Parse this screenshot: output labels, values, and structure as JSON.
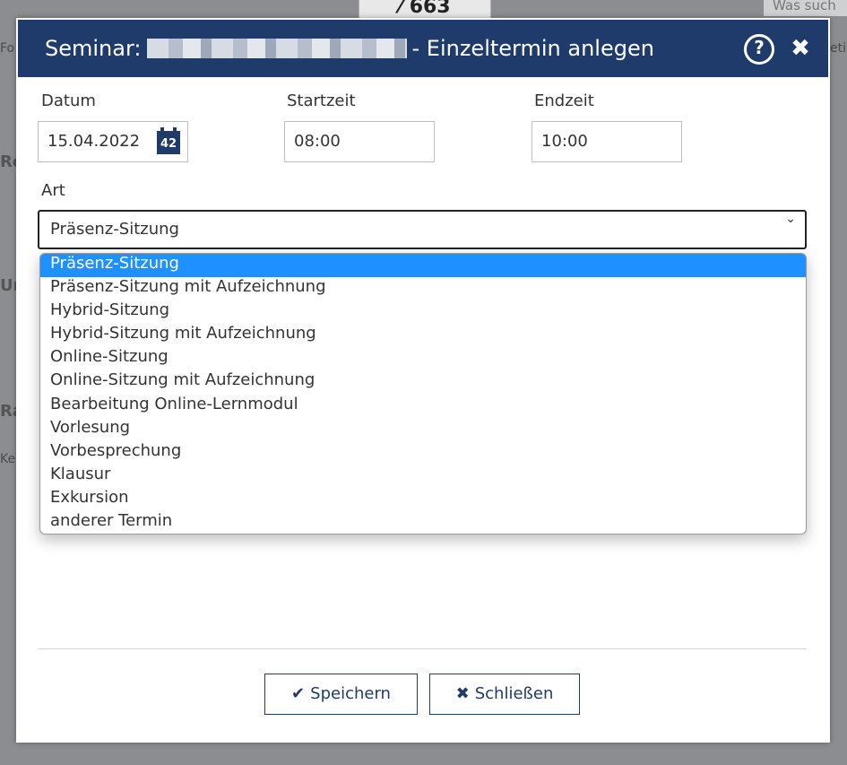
{
  "background": {
    "badge": "⁄ 663",
    "search_placeholder": "Was such",
    "fragments": [
      "Fo",
      "Re",
      "Un",
      "Ra",
      "Ke",
      "etin"
    ]
  },
  "dialog": {
    "title_prefix": "Seminar:",
    "title_suffix": "- Einzeltermin anlegen",
    "help_icon": "help-icon",
    "close_icon": "close-icon",
    "date_label": "Datum",
    "date_value": "15.04.2022",
    "calendar_day": "42",
    "start_label": "Startzeit",
    "start_value": "08:00",
    "end_label": "Endzeit",
    "end_value": "10:00",
    "art_label": "Art",
    "art_selected": "Präsenz-Sitzung",
    "art_options": [
      "Präsenz-Sitzung",
      "Präsenz-Sitzung mit Aufzeichnung",
      "Hybrid-Sitzung",
      "Hybrid-Sitzung mit Aufzeichnung",
      "Online-Sitzung",
      "Online-Sitzung mit Aufzeichnung",
      "Bearbeitung Online-Lernmodul",
      "Vorlesung",
      "Vorbesprechung",
      "Klausur",
      "Exkursion",
      "anderer Termin"
    ],
    "save_label": "Speichern",
    "cancel_label": "Schließen"
  },
  "colors": {
    "brand": "#1f3b6b",
    "selected_option": "#1e90ff"
  }
}
